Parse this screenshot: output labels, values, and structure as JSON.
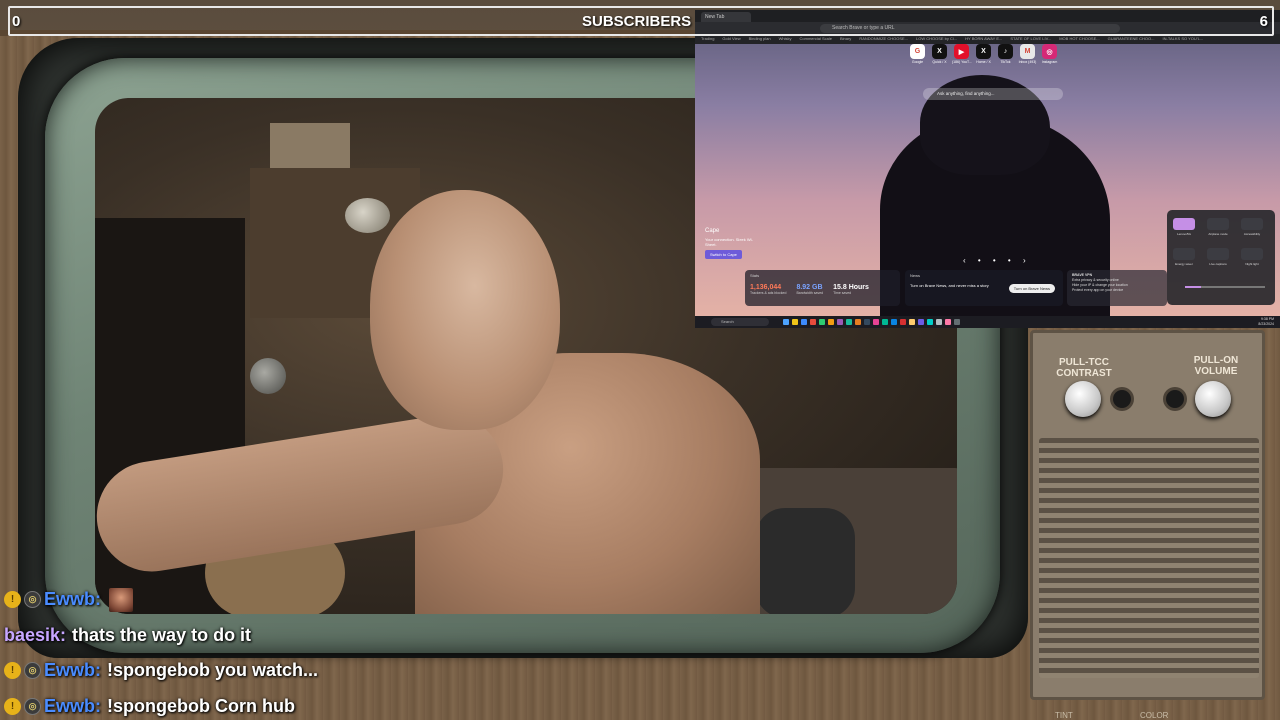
{
  "overlay": {
    "subscribers_label": "SUBSCRIBERS",
    "left_count": "0",
    "right_count": "6"
  },
  "tv_panel": {
    "left_knob_label": "PULL-TCC CONTRAST",
    "right_knob_label": "PULL-ON VOLUME",
    "bottom_left_label": "TINT",
    "bottom_right_label": "COLOR"
  },
  "browser": {
    "tab_title": "New Tab",
    "address_placeholder": "Search Brave or type a URL",
    "bookmarks": [
      "Trading",
      "Gold View",
      "Binding plan",
      "Whisky",
      "Commercial Scale",
      "Binary",
      "RANDONMIZE CHOOSE...",
      "LOW CHOOSE by Cl...",
      "HY BORN AWAY E...",
      "STATE OF LOVE LIV...",
      "MOB HOT CHOOSE...",
      "GUARANTEENE CHOO...",
      "IN-TALKS SO YOU'L..."
    ],
    "shortcuts": [
      {
        "label": "Google",
        "icon": "google-icon",
        "glyph": "G",
        "color": "#ffffff"
      },
      {
        "label": "Quick / X",
        "icon": "x-icon",
        "glyph": "X",
        "color": "#111111"
      },
      {
        "label": "(186) YouT...",
        "icon": "youtube-icon",
        "glyph": "▶",
        "color": "#e2102a"
      },
      {
        "label": "Home / X",
        "icon": "x-icon",
        "glyph": "X",
        "color": "#111111"
      },
      {
        "label": "TikTok",
        "icon": "tiktok-icon",
        "glyph": "♪",
        "color": "#111111"
      },
      {
        "label": "Inbox (493)",
        "icon": "gmail-icon",
        "glyph": "M",
        "color": "#e8e8e8"
      },
      {
        "label": "Instagram",
        "icon": "instagram-icon",
        "glyph": "◎",
        "color": "#d62976"
      }
    ],
    "search_placeholder": "Ask anything, find anything...",
    "cape": {
      "title": "Cape",
      "text": "Your connection. Sleek Wi-Sheet.",
      "button": "Switch to Cape"
    },
    "stats": {
      "title": "Stats",
      "items": [
        {
          "value": "1,136,044",
          "label": "Trackers & ads blocked",
          "color": "#ff7a59"
        },
        {
          "value": "8.92 GB",
          "label": "Bandwidth saved",
          "color": "#7aa3ff"
        },
        {
          "value": "15.8 Hours",
          "label": "Time saved",
          "color": "#ffffff"
        }
      ]
    },
    "news": {
      "title": "News",
      "text": "Turn on Brave News, and never miss a story",
      "button": "Turn on Brave News"
    },
    "vpn": {
      "title": "BRAVE VPN",
      "lines": [
        "Extra privacy & security online",
        "Hide your IP & change your location",
        "Protect every app on your device"
      ]
    },
    "quick_settings": [
      "Lenovo5G",
      "Airplane mode",
      "Accessibility",
      "Energy saver",
      "Live captions",
      "Night light"
    ],
    "taskbar_search": "Search",
    "clock_time": "9:38 PM",
    "clock_date": "8/23/2024",
    "taskbar_icon_colors": [
      "#4da3ff",
      "#f0c419",
      "#3d8bfd",
      "#e74c3c",
      "#2ecc71",
      "#f39c12",
      "#9b59b6",
      "#1abc9c",
      "#e67e22",
      "#34495e",
      "#e84393",
      "#00b894",
      "#0984e3",
      "#d63031",
      "#fdcb6e",
      "#6c5ce7",
      "#00cec9",
      "#b2bec3",
      "#fd79a8",
      "#636e72"
    ]
  },
  "chat": [
    {
      "user": "Ewwb:",
      "user_color": "#4a8cff",
      "badges": true,
      "message": "",
      "emote": true
    },
    {
      "user": "baesik:",
      "user_color": "#c7a6ff",
      "badges": false,
      "message": "thats the way to do it",
      "emote": false
    },
    {
      "user": "Ewwb:",
      "user_color": "#4a8cff",
      "badges": true,
      "message": "!spongebob you watch...",
      "emote": false
    },
    {
      "user": "Ewwb:",
      "user_color": "#4a8cff",
      "badges": true,
      "message": "!spongebob Corn hub",
      "emote": false
    }
  ]
}
